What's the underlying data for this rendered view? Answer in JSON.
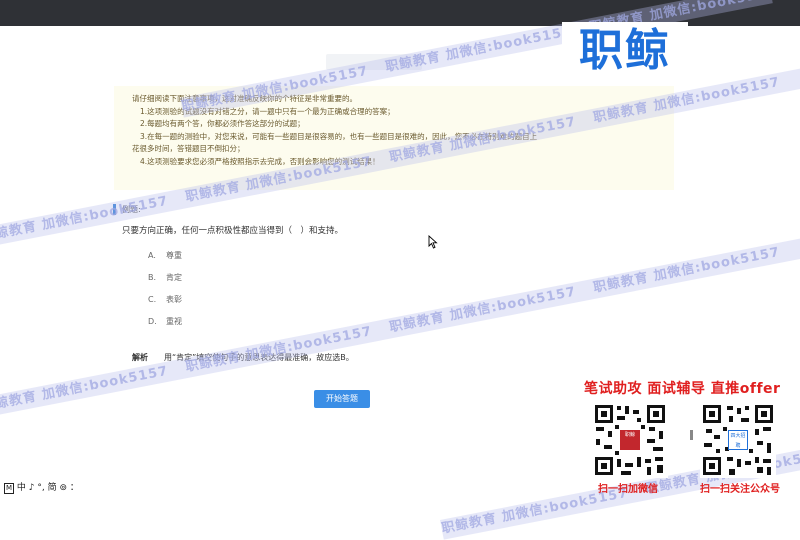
{
  "header": {
    "hint_button": ""
  },
  "notice": {
    "intro": "请仔细阅读下面注意事项，这对准确反映你的个特征是非常重要的。",
    "lines": [
      "1.这项测验的试题没有对错之分，请一题中只有一个最为正确或合理的答案；",
      "2.每题均有两个答，你都必须作答这部分的试题；",
      "3.在每一题的测验中，对您来说，可能有一些题目是很容易的，也有一些题目是很难的，因此，您不必在特别难的题目上",
      "花很多时间，答错题目不倒扣分；",
      "4.这项测验要求您必须严格按照指示去完成，否则会影响您的测试结果！"
    ]
  },
  "example": {
    "label": "例题:",
    "question": "只要方向正确，任何一点积极性都应当得到（　）和支持。",
    "options": [
      {
        "letter": "A.",
        "text": "尊重"
      },
      {
        "letter": "B.",
        "text": "肯定"
      },
      {
        "letter": "C.",
        "text": "表彰"
      },
      {
        "letter": "D.",
        "text": "重视"
      }
    ],
    "analysis_label": "解析",
    "analysis_text": "用“肯定”填空使句子的意思表达得最准确，故应选B。"
  },
  "start_button": "开始答题",
  "ime_bar": {
    "box": "M",
    "rest": "中 ♪ °, 简 ⊚ ："
  },
  "watermark": {
    "text": "职鲸教育 加微信:book5157"
  },
  "logo": {
    "text": "职鲸"
  },
  "promo": {
    "title": "笔试助攻  面试辅导  直推offer",
    "qr1_caption": "扫一扫加微信",
    "qr2_caption": "扫一扫关注公众号",
    "qr1_center": "职鲸",
    "qr2_center": "四大招聘"
  },
  "colors": {
    "accent": "#3a8ee6",
    "promo_red": "#e02020",
    "logo_blue": "#1e6fd9",
    "notice_bg": "#fdfcee"
  },
  "icons": {
    "cursor": "mouse-pointer-icon"
  }
}
